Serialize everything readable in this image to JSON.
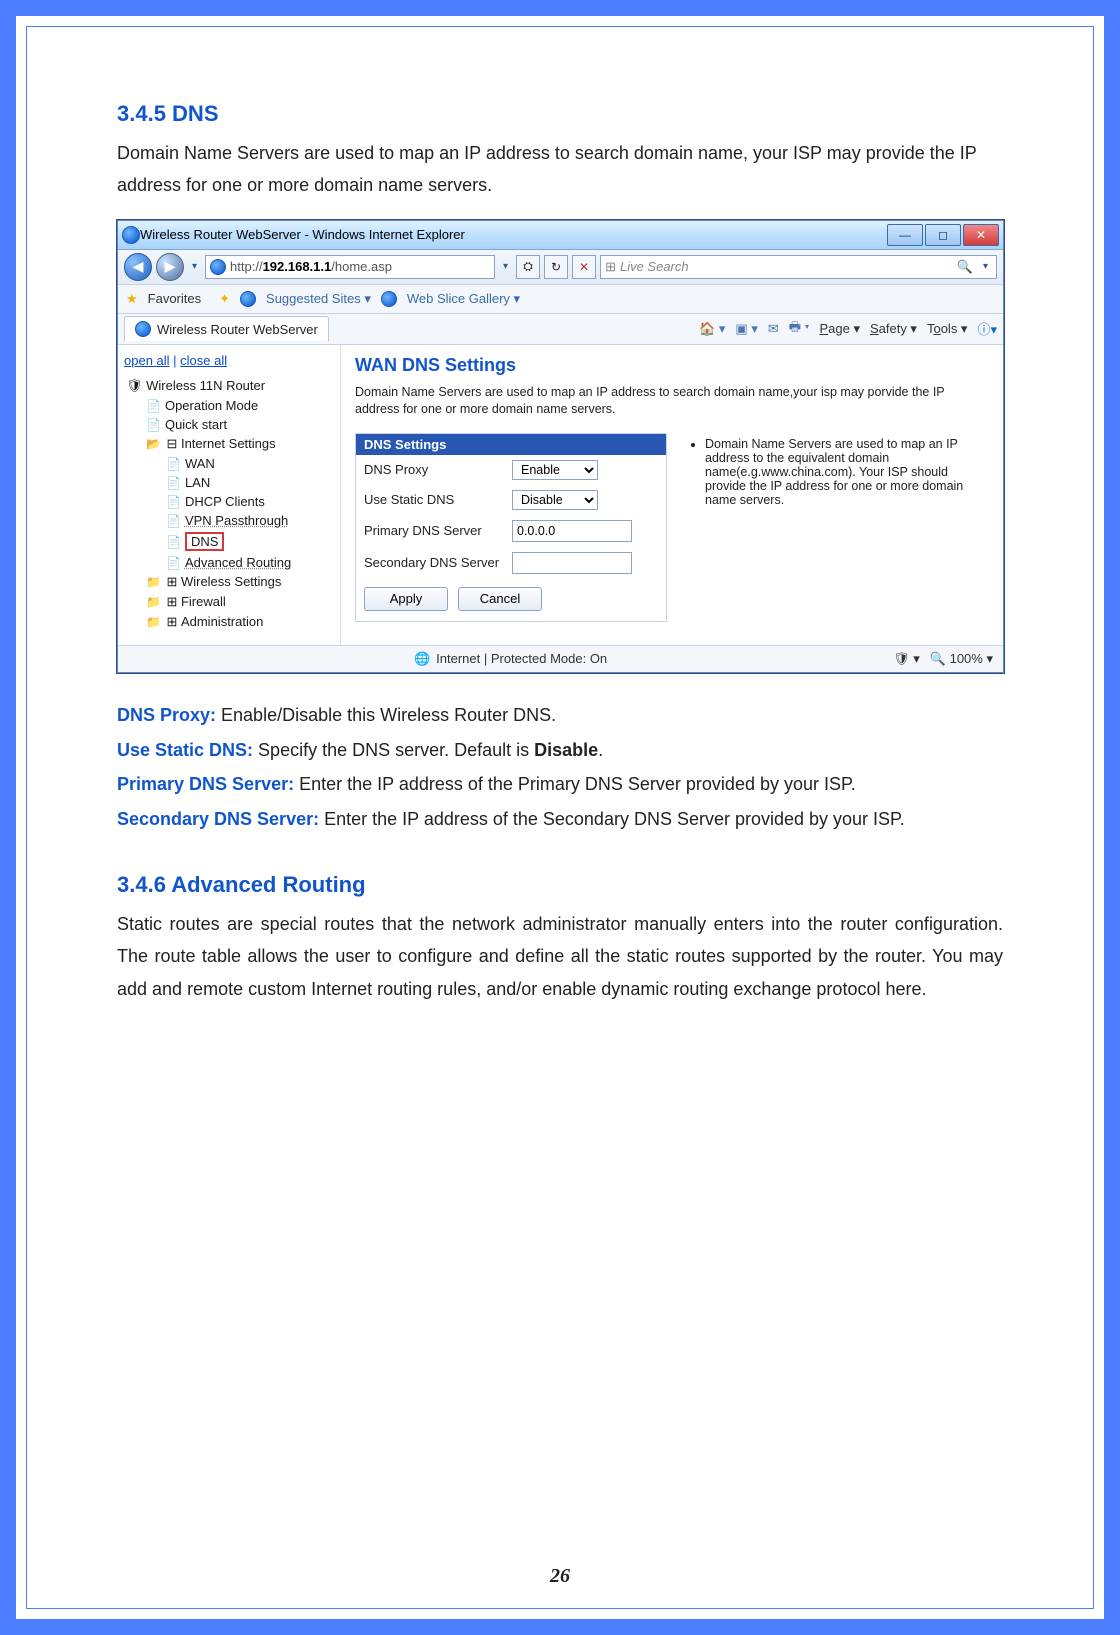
{
  "section_dns": {
    "heading": "3.4.5   DNS",
    "intro": "Domain Name Servers are used to map an IP address to search domain name, your ISP may provide the IP address for one or more domain name servers."
  },
  "ie": {
    "title": "Wireless Router WebServer - Windows Internet Explorer",
    "url_prefix": "http://",
    "url_host": "192.168.1.1",
    "url_path": "/home.asp",
    "search_placeholder": "Live Search",
    "favorites_label": "Favorites",
    "suggested_sites": "Suggested Sites",
    "web_slice": "Web Slice Gallery",
    "tab_label": "Wireless Router WebServer",
    "cmd_page": "Page",
    "cmd_safety": "Safety",
    "cmd_tools": "Tools",
    "status_text": "Internet | Protected Mode: On",
    "zoom": "100%"
  },
  "sidebar": {
    "open_all": "open all",
    "close_all": "close all",
    "root": "Wireless 11N Router",
    "items": {
      "op_mode": "Operation Mode",
      "quick": "Quick start",
      "internet": "Internet Settings",
      "wan": "WAN",
      "lan": "LAN",
      "dhcp": "DHCP Clients",
      "vpn": "VPN Passthrough",
      "dns": "DNS",
      "adv_route": "Advanced Routing",
      "wireless": "Wireless Settings",
      "firewall": "Firewall",
      "admin": "Administration"
    }
  },
  "wan": {
    "title": "WAN DNS Settings",
    "intro": "Domain Name Servers are used to map an IP address to search domain name,your isp may porvide the IP address for one or more domain name servers.",
    "legend": "DNS Settings",
    "row_proxy": "DNS Proxy",
    "row_static": "Use Static DNS",
    "row_primary": "Primary DNS Server",
    "row_secondary": "Secondary DNS Server",
    "val_enable": "Enable",
    "val_disable": "Disable",
    "val_primary": "0.0.0.0",
    "val_secondary": "",
    "btn_apply": "Apply",
    "btn_cancel": "Cancel",
    "info": "Domain Name Servers are used to map an IP address to the equivalent domain name(e.g.www.china.com). Your ISP should provide the IP address for one or more domain name servers."
  },
  "defs": {
    "dns_proxy_l": "DNS Proxy:",
    "dns_proxy_t": " Enable/Disable this Wireless Router DNS.",
    "static_l": "Use Static DNS:",
    "static_t1": " Specify the DNS server. Default is ",
    "static_bold": "Disable",
    "static_t2": ".",
    "primary_l": "Primary DNS Server:",
    "primary_t": " Enter the IP address of the Primary DNS Server provided by your ISP.",
    "secondary_l": "Secondary DNS Server:",
    "secondary_t": " Enter the IP address of the Secondary DNS Server provided by your ISP."
  },
  "section_adv": {
    "heading": "3.4.6   Advanced Routing",
    "body": "Static routes are special routes that the network administrator manually enters into the router configuration. The route table allows the user to configure and define all the static routes supported by the router. You may add and remote custom Internet routing rules, and/or enable dynamic routing exchange protocol here."
  },
  "page_number": "26"
}
